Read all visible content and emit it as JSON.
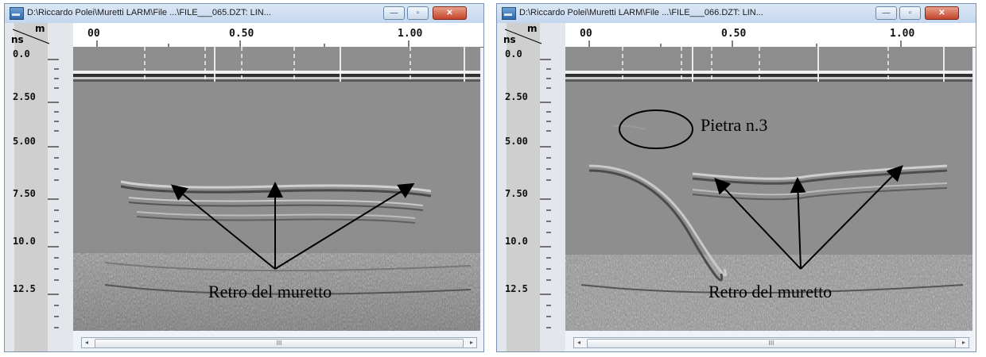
{
  "windows": [
    {
      "title": "D:\\Riccardo Polei\\Muretti LARM\\File ...\\FILE___065.DZT:  LIN...",
      "x_ticks": [
        "00",
        "0.50",
        "1.00"
      ],
      "y_ticks": [
        "0.0",
        "2.50",
        "5.00",
        "7.50",
        "10.0",
        "12.5"
      ],
      "axis_unit_x": "m",
      "axis_unit_y": "ns",
      "annotation": "Retro del muretto"
    },
    {
      "title": "D:\\Riccardo Polei\\Muretti LARM\\File ...\\FILE___066.DZT:  LIN...",
      "x_ticks": [
        "00",
        "0.50",
        "1.00"
      ],
      "y_ticks": [
        "0.0",
        "2.50",
        "5.00",
        "7.50",
        "10.0",
        "12.5"
      ],
      "axis_unit_x": "m",
      "axis_unit_y": "ns",
      "annotation": "Retro del muretto",
      "annotation2": "Pietra n.3"
    }
  ],
  "controls": {
    "minimize": "—",
    "maximize": "▫",
    "close": "✕"
  },
  "scrollbar": {
    "left_arrow": "◂",
    "right_arrow": "▸",
    "grip": "III"
  },
  "colors": {
    "titlebar": "#c3d6ee",
    "radargram_bg": "#8c8c8c",
    "close_button": "#c4442a"
  }
}
